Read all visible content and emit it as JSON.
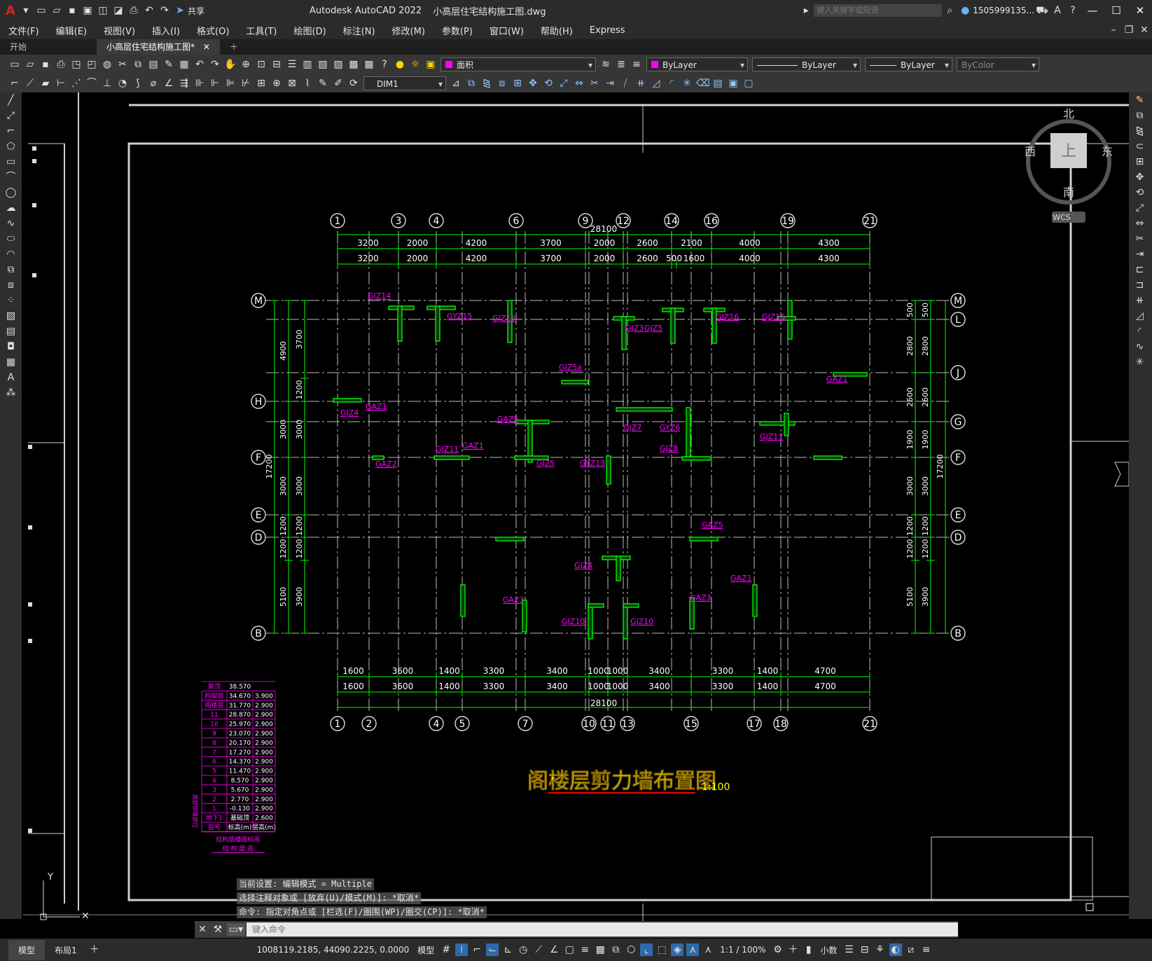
{
  "window": {
    "app_title": "Autodesk AutoCAD 2022",
    "file_title": "小高层住宅结构施工图.dwg",
    "share": "共享",
    "search_placeholder": "键入关键字或短语",
    "user": "1505999135...",
    "brand_color": "#d7261e"
  },
  "menu": [
    "文件(F)",
    "编辑(E)",
    "视图(V)",
    "插入(I)",
    "格式(O)",
    "工具(T)",
    "绘图(D)",
    "标注(N)",
    "修改(M)",
    "参数(P)",
    "窗口(W)",
    "帮助(H)",
    "Express"
  ],
  "tabs": {
    "start": "开始",
    "active": "小高层住宅结构施工图*"
  },
  "toolbar": {
    "layer": "面积",
    "color": "ByLayer",
    "linetype": "ByLayer",
    "lineweight": "ByLayer",
    "plotstyle": "ByColor",
    "dimstyle": "DIM1"
  },
  "viewcube": {
    "north": "北",
    "south": "南",
    "west": "西",
    "east": "东",
    "top": "上",
    "wcs": "WCS"
  },
  "drawing": {
    "title": "阁楼层剪力墙布置图",
    "scale": "1:100",
    "top_total": "28100",
    "bottom_total": "28100",
    "top_axes": [
      "1",
      "3",
      "4",
      "6",
      "9",
      "12",
      "14",
      "16",
      "19",
      "21"
    ],
    "bottom_axes": [
      "1",
      "2",
      "4",
      "5",
      "7",
      "10",
      "11",
      "13",
      "15",
      "17",
      "18",
      "21"
    ],
    "left_axes": [
      "M",
      "H",
      "F",
      "E",
      "D",
      "B"
    ],
    "right_axes": [
      "M",
      "L",
      "J",
      "G",
      "F",
      "E",
      "D",
      "B"
    ],
    "top_dims_1": [
      "3200",
      "2000",
      "4200",
      "3700",
      "2000",
      "2600",
      "2100",
      "4000",
      "4300"
    ],
    "top_dims_2": [
      "3200",
      "2000",
      "4200",
      "3700",
      "2000",
      "2600",
      "500",
      "1600",
      "4000",
      "4300"
    ],
    "bottom_dims": [
      "1600",
      "3600",
      "1400",
      "3300",
      "3400",
      "1000",
      "1000",
      "3400",
      "3300",
      "1400",
      "4700"
    ],
    "left_dims_outer": [
      "4900",
      "3000",
      "3000",
      "1200",
      "1200",
      "5100"
    ],
    "left_dims_inner": [
      "3700",
      "1200",
      "3000",
      "3000",
      "1200",
      "1200",
      "3900"
    ],
    "left_total": "17200",
    "right_total": "17200",
    "right_dims_a": [
      "500",
      "2800",
      "2600",
      "1900",
      "3000",
      "1200",
      "1200",
      "5100"
    ],
    "right_dims_b": [
      "500",
      "2800",
      "2600",
      "1900",
      "3000",
      "1200",
      "1200",
      "3900"
    ],
    "wall_labels": [
      "GJZ14",
      "GYZ15",
      "GJZ13",
      "GJZ3",
      "GJZ5",
      "GJZ16",
      "GJZ16",
      "GAZ1",
      "GJZ5a",
      "GJZ4",
      "GAZ1",
      "GJZ8",
      "GJZ7",
      "GYZ6",
      "GJZ17",
      "GJZ11",
      "GAZ2",
      "GJZ5",
      "GYZ13",
      "GAZ5",
      "GAZ1",
      "GAZ5",
      "GJZ4",
      "GAZ3",
      "GJZ10",
      "GJZ10",
      "GAZ3",
      "GAZ1"
    ],
    "floor_table": {
      "header": [
        "屋顶",
        "38.570",
        ""
      ],
      "rows": [
        [
          "构架层",
          "34.670",
          "3.900"
        ],
        [
          "阁楼层",
          "31.770",
          "2.900"
        ],
        [
          "11",
          "28.870",
          "2.900"
        ],
        [
          "10",
          "25.970",
          "2.900"
        ],
        [
          "9",
          "23.070",
          "2.900"
        ],
        [
          "8",
          "20.170",
          "2.900"
        ],
        [
          "7",
          "17.270",
          "2.900"
        ],
        [
          "6",
          "14.370",
          "2.900"
        ],
        [
          "5",
          "11.470",
          "2.900"
        ],
        [
          "4",
          "8.570",
          "2.900"
        ],
        [
          "3",
          "5.670",
          "2.900"
        ],
        [
          "2",
          "2.770",
          "2.900"
        ],
        [
          "1",
          "-0.130",
          "2.900"
        ],
        [
          "地下1",
          "基础顶",
          "2.600"
        ]
      ],
      "footer": [
        "层号",
        "标高(m)",
        "层高(m)"
      ],
      "caption": "结构层楼面标高",
      "caption2": "结 构 层 高",
      "side": "底部加强部位"
    }
  },
  "command": {
    "line1": "当前设置: 编辑模式 = Multiple",
    "line2": "选择注释对象或 [放弃(U)/模式(M)]: *取消*",
    "line3": "命令: 指定对角点或 [栏选(F)/圈围(WP)/圈交(CP)]: *取消*",
    "placeholder": "键入命令"
  },
  "status": {
    "model_tab": "模型",
    "layout_tab": "布局1",
    "coords": "1008119.2185, 44090.2225, 0.0000",
    "space": "模型",
    "scale": "1:1 / 100%",
    "units": "小数"
  },
  "colors": {
    "green": "#00ff00",
    "magenta": "#ff00ff",
    "cyan": "#00ffff",
    "yellow": "#ffff00",
    "red": "#ff0000",
    "white": "#ffffff"
  }
}
